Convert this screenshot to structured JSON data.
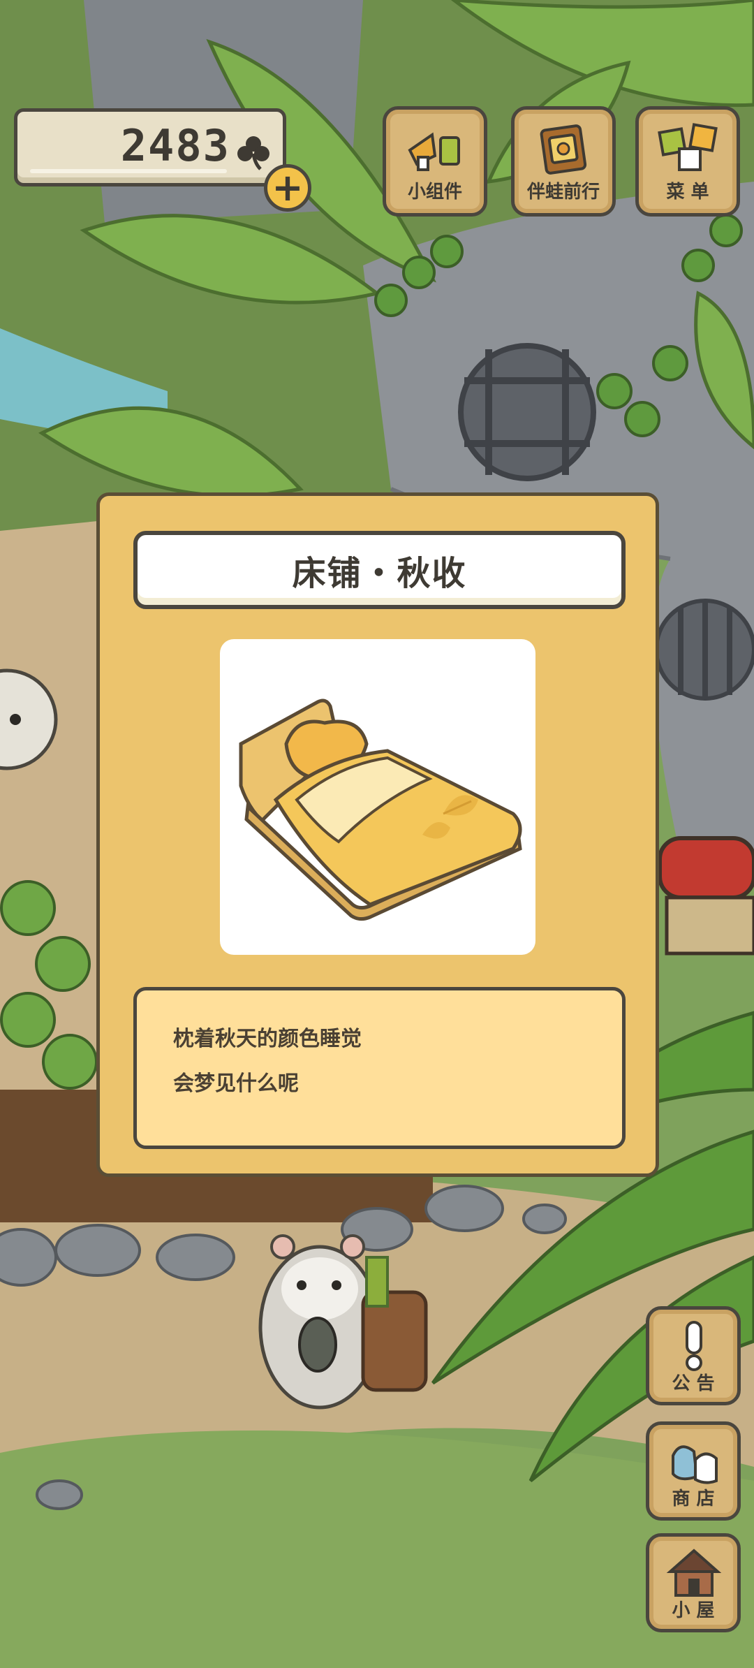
{
  "hud": {
    "clover_count": "2483"
  },
  "top_menu": [
    {
      "label": "小组件",
      "icon": "widget-icon"
    },
    {
      "label": "伴蛙前行",
      "icon": "travel-book-icon"
    },
    {
      "label": "菜 单",
      "icon": "menu-icon"
    }
  ],
  "side_menu": [
    {
      "label": "公 告",
      "icon": "exclamation-icon"
    },
    {
      "label": "商 店",
      "icon": "shop-bag-icon"
    },
    {
      "label": "小 屋",
      "icon": "house-icon"
    }
  ],
  "item_dialog": {
    "title": "床铺・秋收",
    "image": "autumn-bed-icon",
    "description": [
      "枕着秋天的颜色睡觉",
      "会梦见什么呢"
    ]
  },
  "colors": {
    "dialog_bg": "#ecc46d",
    "desc_bg": "#ffdf9a",
    "button_wood": "#d9b77a",
    "outline": "#4a463e"
  }
}
